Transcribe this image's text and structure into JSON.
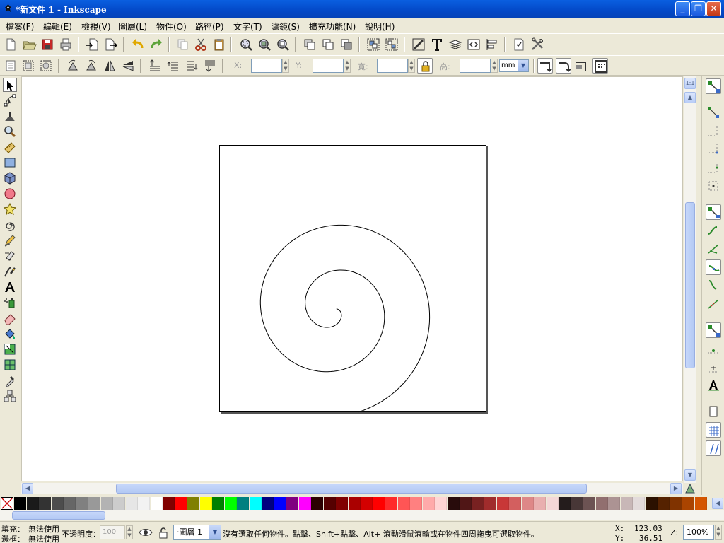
{
  "window": {
    "title": "*新文件 1 - Inkscape",
    "buttons": {
      "minimize": "_",
      "maximize": "❐",
      "close": "✕"
    }
  },
  "menu": [
    {
      "label": "檔案(F)"
    },
    {
      "label": "編輯(E)"
    },
    {
      "label": "檢視(V)"
    },
    {
      "label": "圖層(L)"
    },
    {
      "label": "物件(O)"
    },
    {
      "label": "路徑(P)"
    },
    {
      "label": "文字(T)"
    },
    {
      "label": "濾鏡(S)"
    },
    {
      "label": "擴充功能(N)"
    },
    {
      "label": "說明(H)"
    }
  ],
  "controls": {
    "x_label": "X:",
    "y_label": "Y:",
    "w_label": "寬:",
    "h_label": "高:",
    "x_value": "",
    "y_value": "",
    "w_value": "",
    "h_value": "",
    "unit": "mm"
  },
  "canvas": {
    "zoom_icon_label": "1:1"
  },
  "palette_colors": [
    "#000000",
    "#1A1A1A",
    "#333333",
    "#4D4D4D",
    "#666666",
    "#808080",
    "#999999",
    "#B3B3B3",
    "#CCCCCC",
    "#E6E6E6",
    "#F2F2F2",
    "#FFFFFF",
    "#800000",
    "#FF0000",
    "#808000",
    "#FFFF00",
    "#008000",
    "#00FF00",
    "#008080",
    "#00FFFF",
    "#000080",
    "#0000FF",
    "#800080",
    "#FF00FF",
    "#2B0000",
    "#550000",
    "#800000",
    "#AA0000",
    "#D40000",
    "#FF0000",
    "#FF2A2A",
    "#FF5555",
    "#FF8080",
    "#FFAAAA",
    "#FFD5D5",
    "#280B0B",
    "#501616",
    "#782121",
    "#A02C2C",
    "#C83737",
    "#D35F5F",
    "#DE8787",
    "#E9AFAF",
    "#F4D7D7",
    "#241C1C",
    "#483737",
    "#6C5353",
    "#916F6F",
    "#AC9393",
    "#C8B7B7",
    "#E3DBDB",
    "#2B1100",
    "#552200",
    "#803300",
    "#AA4400",
    "#D45500",
    "#FF6600"
  ],
  "status": {
    "fill_label": "填充：",
    "fill_value": "無法使用",
    "stroke_label": "邊框：",
    "stroke_value": "無法使用",
    "opacity_label": "不透明度：",
    "opacity_value": "100",
    "layer_value": "·圖層 1",
    "message": "沒有選取任何物件。點擊、Shift+點擊、Alt+ 滾動滑鼠滾輪或在物件四周拖曳可選取物件。",
    "x_label": "X:",
    "x_value": "123.03",
    "y_label": "Y:",
    "y_value": "36.51",
    "z_label": "Z:",
    "zoom_value": "100%"
  }
}
